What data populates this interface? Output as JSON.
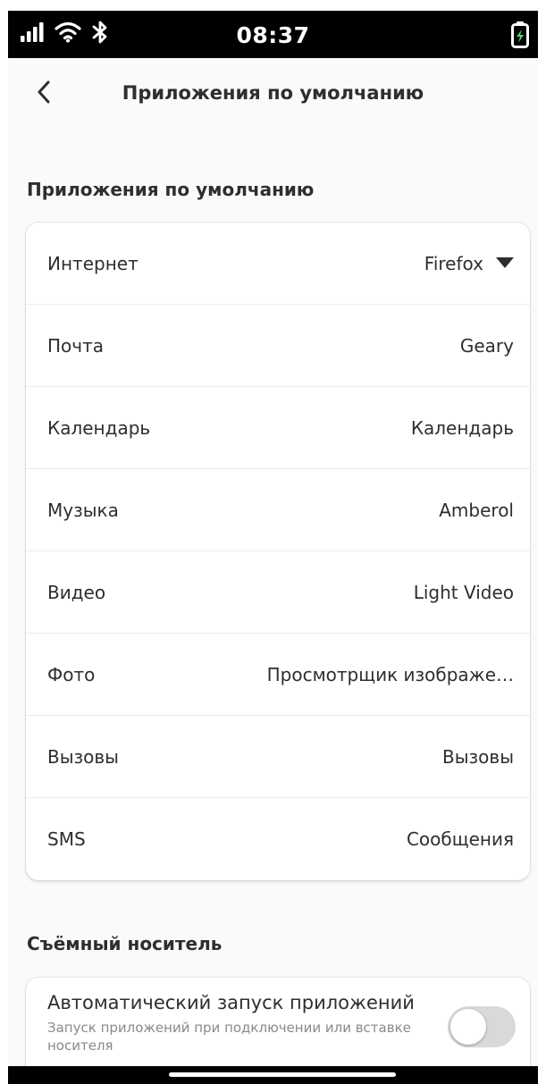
{
  "status_bar": {
    "time": "08:37",
    "icons": [
      "signal-icon",
      "wifi-icon",
      "bluetooth-icon",
      "battery-charging-icon"
    ]
  },
  "header": {
    "title": "Приложения по умолчанию"
  },
  "default_apps": {
    "section_title": "Приложения по умолчанию",
    "rows": [
      {
        "label": "Интернет",
        "value": "Firefox"
      },
      {
        "label": "Почта",
        "value": "Geary"
      },
      {
        "label": "Календарь",
        "value": "Календарь"
      },
      {
        "label": "Музыка",
        "value": "Amberol"
      },
      {
        "label": "Видео",
        "value": "Light Video"
      },
      {
        "label": "Фото",
        "value": "Просмотрщик изображе…"
      },
      {
        "label": "Вызовы",
        "value": "Вызовы"
      },
      {
        "label": "SMS",
        "value": "Сообщения"
      }
    ]
  },
  "removable_media": {
    "section_title": "Съёмный носитель",
    "autorun": {
      "title": "Автоматический запуск приложений",
      "subtitle": "Запуск приложений при подключении или вставке носителя",
      "enabled": false
    }
  },
  "colors": {
    "background": "#fafafa",
    "card": "#ffffff",
    "text": "#2e2e2e",
    "subtitle": "#8a8a8a",
    "switch_off": "#d9d9d9"
  }
}
